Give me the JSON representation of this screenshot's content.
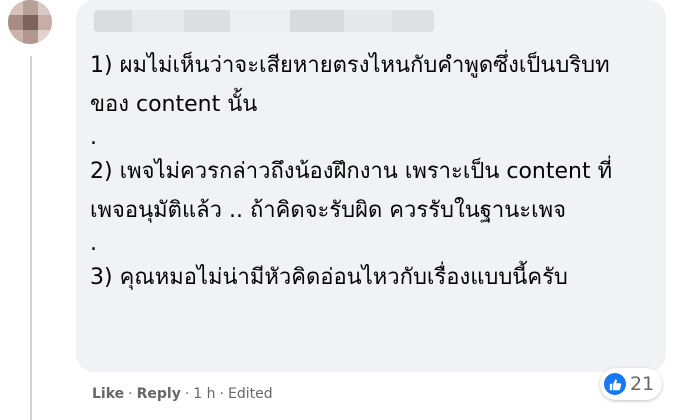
{
  "comment": {
    "author_name": "",
    "paragraphs": [
      "1) ผมไม่เห็นว่าจะเสียหายตรงไหนกับคำพูดซึ่งเป็นบริบทของ content นั้น",
      ".",
      "2) เพจไม่ควรกล่าวถึงน้องฝึกงาน เพราะเป็น content ที่เพจอนุมัติแล้ว .. ถ้าคิดจะรับผิด ควรรับในฐานะเพจ",
      ".",
      "3) คุณหมอไม่น่ามีหัวคิดอ่อนไหวกับเรื่องแบบนี้ครับ"
    ]
  },
  "actions": {
    "like": "Like",
    "separator": "·",
    "reply": "Reply",
    "time": "1 h",
    "edited": "Edited"
  },
  "reactions": {
    "icon": "like-thumb-icon",
    "count": "21",
    "color": "#1877f2"
  },
  "colors": {
    "bubble": "#f0f2f5",
    "meta_text": "#65676b",
    "body_text": "#050505"
  }
}
